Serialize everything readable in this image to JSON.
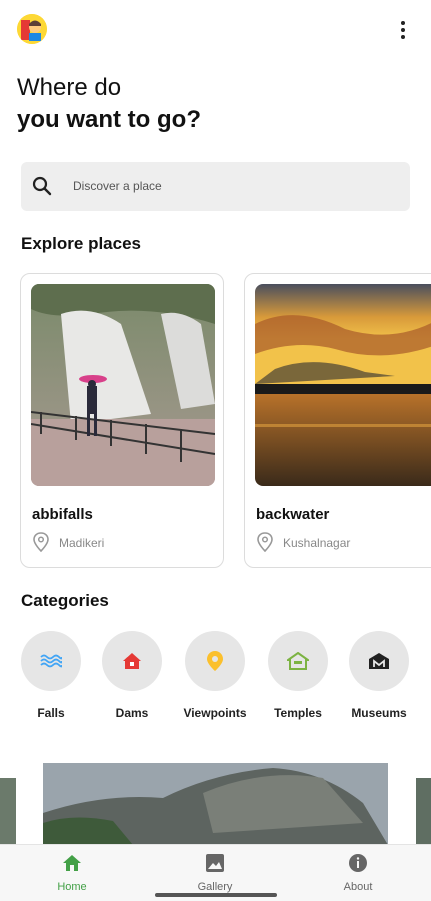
{
  "header": {
    "line1": "Where do",
    "line2": "you want to go?"
  },
  "search": {
    "placeholder": "Discover a place"
  },
  "explore": {
    "title": "Explore places",
    "places": [
      {
        "name": "abbifalls",
        "location": "Madikeri"
      },
      {
        "name": "backwater",
        "location": "Kushalnagar"
      }
    ]
  },
  "categories": {
    "title": "Categories",
    "items": [
      {
        "label": "Falls",
        "icon": "waves-icon",
        "color": "#42a5f5"
      },
      {
        "label": "Dams",
        "icon": "dam-icon",
        "color": "#e53935"
      },
      {
        "label": "Viewpoints",
        "icon": "location-pin-icon",
        "color": "#fbc02d"
      },
      {
        "label": "Temples",
        "icon": "temple-icon",
        "color": "#7cb342"
      },
      {
        "label": "Museums",
        "icon": "museum-icon",
        "color": "#212121"
      }
    ]
  },
  "bottom_nav": {
    "items": [
      {
        "label": "Home",
        "icon": "home-icon",
        "active": true,
        "color": "#43a047"
      },
      {
        "label": "Gallery",
        "icon": "gallery-icon",
        "active": false,
        "color": "#666666"
      },
      {
        "label": "About",
        "icon": "info-icon",
        "active": false,
        "color": "#666666"
      }
    ]
  }
}
